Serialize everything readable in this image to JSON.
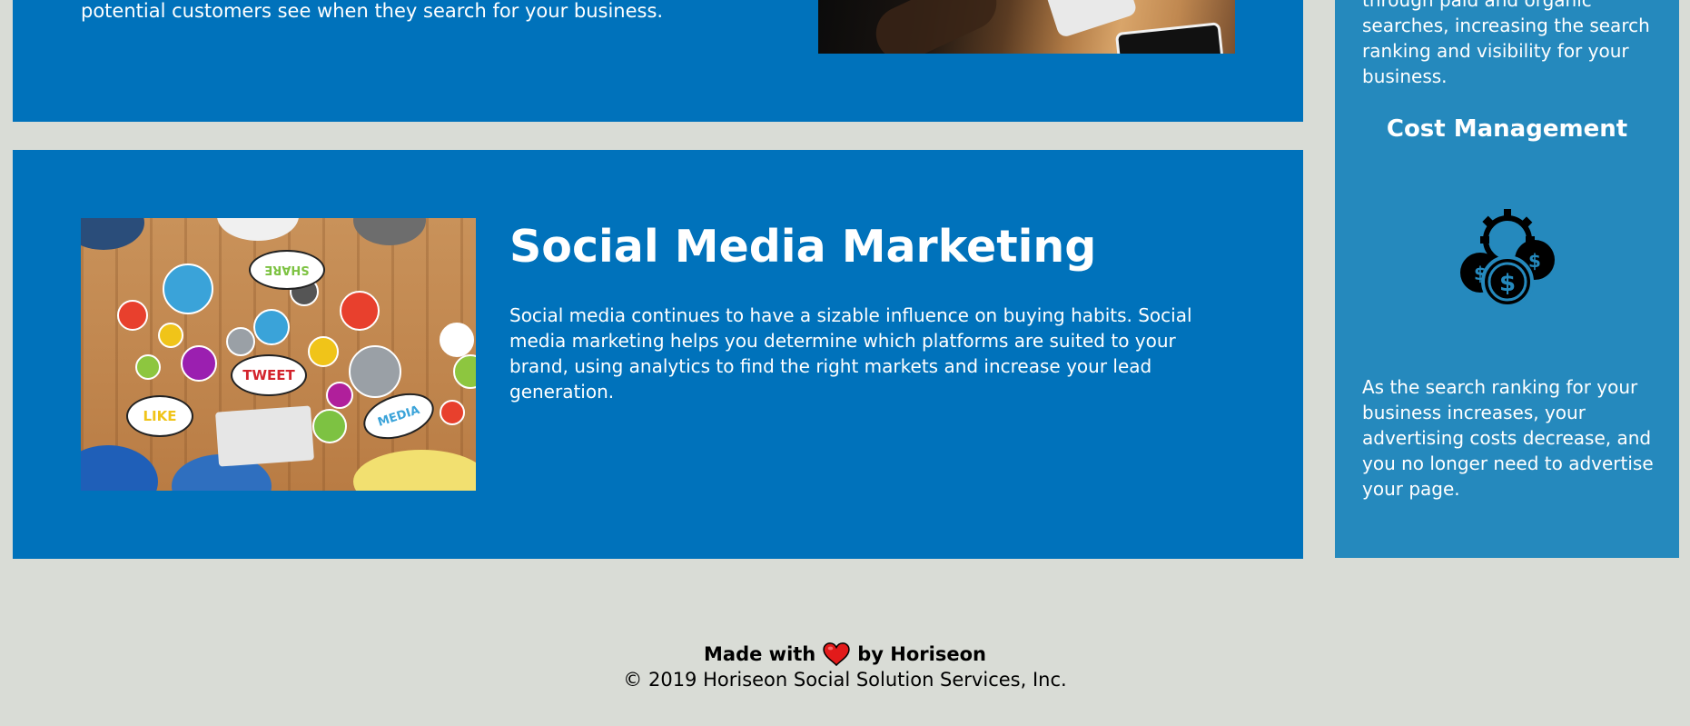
{
  "seo_section": {
    "text_tail": "potential customers see when they search for your business."
  },
  "social_section": {
    "title": "Social Media Marketing",
    "body": "Social media continues to have a sizable influence on buying habits. Social media marketing helps you determine which platforms are suited to your brand, using analytics to find the right markets and increase your lead generation.",
    "image_words": [
      "SHARE",
      "TWEET",
      "LIKE",
      "MEDIA"
    ]
  },
  "sidebar": {
    "text_tail": "through paid and organic searches, increasing the search ranking and visibility for your business.",
    "cost_heading": "Cost Management",
    "cost_text": "As the search ranking for your business increases, your advertising costs decrease, and you no longer need to advertise your page."
  },
  "footer": {
    "made_prefix": "Made with",
    "made_suffix": "by Horiseon",
    "copyright": "© 2019 Horiseon Social Solution Services, Inc."
  },
  "colors": {
    "page_bg": "#d9dcd6",
    "article_bg": "#0072bb",
    "sidebar_bg": "#2589bd",
    "heart": "#e21a1a"
  },
  "icons": [
    "cost-management-icon",
    "heart-icon"
  ]
}
